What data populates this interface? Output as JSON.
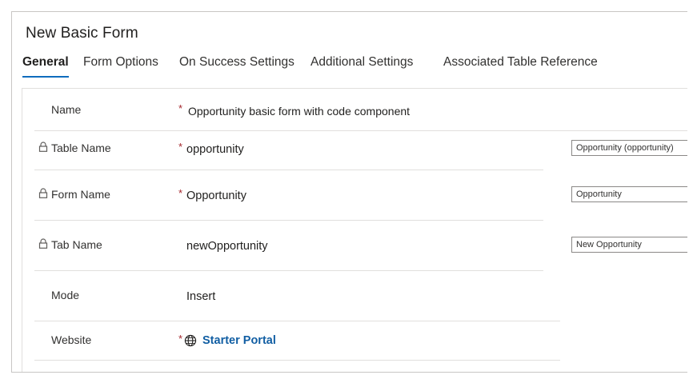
{
  "form": {
    "title": "New Basic Form"
  },
  "tabs": [
    {
      "label": "General",
      "active": true
    },
    {
      "label": "Form Options",
      "active": false
    },
    {
      "label": "On Success Settings",
      "active": false
    },
    {
      "label": "Additional Settings",
      "active": false
    },
    {
      "label": "Associated Table Reference",
      "active": false
    }
  ],
  "fields": {
    "name": {
      "label": "Name",
      "required": "*",
      "value": "Opportunity basic form with code component"
    },
    "table_name": {
      "label": "Table Name",
      "required": "*",
      "value": "opportunity",
      "side_value": "Opportunity (opportunity)"
    },
    "form_name": {
      "label": "Form Name",
      "required": "*",
      "value": "Opportunity",
      "side_value": "Opportunity"
    },
    "tab_name": {
      "label": "Tab Name",
      "value": "newOpportunity",
      "side_value": "New Opportunity"
    },
    "mode": {
      "label": "Mode",
      "value": "Insert"
    },
    "website": {
      "label": "Website",
      "required": "*",
      "value": "Starter Portal"
    }
  },
  "colors": {
    "accent": "#0f6cbd",
    "required": "#a4262c",
    "link": "#115ea3"
  },
  "icons": {
    "lock": "lock-icon",
    "globe": "globe-icon"
  }
}
